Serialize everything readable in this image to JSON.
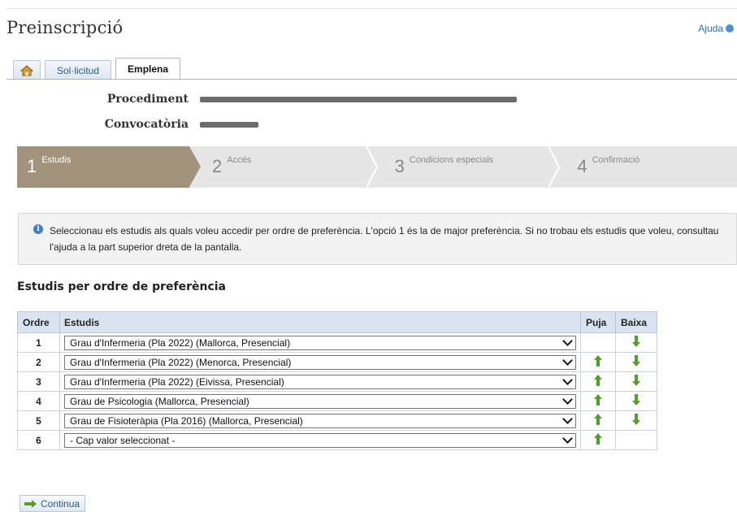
{
  "page": {
    "title": "Preinscripció",
    "help_label": "Ajuda"
  },
  "tabs": [
    {
      "name": "home",
      "label": ""
    },
    {
      "name": "solicitud",
      "label": "Sol·licitud"
    },
    {
      "name": "emplena",
      "label": "Emplena"
    }
  ],
  "info": {
    "procediment_label": "Procediment",
    "convocatoria_label": "Convocatòria"
  },
  "steps": [
    {
      "num": "1",
      "label": "Estudis",
      "active": true
    },
    {
      "num": "2",
      "label": "Accés"
    },
    {
      "num": "3",
      "label": "Condicions especials"
    },
    {
      "num": "4",
      "label": "Confirmació"
    }
  ],
  "notice": "Seleccionau els estudis als quals voleu accedir per ordre de preferència. L'opció 1 és la de major preferència. Si no trobau els estudis que voleu, consultau l'ajuda a la part superior dreta de la pantalla.",
  "section_title": "Estudis per ordre de preferència",
  "table": {
    "headers": {
      "ordre": "Ordre",
      "estudis": "Estudis",
      "puja": "Puja",
      "baixa": "Baixa"
    },
    "rows": [
      {
        "ordre": "1",
        "estudi": "Grau d'Infermeria (Pla 2022) (Mallorca, Presencial)",
        "puja": false,
        "baixa": true
      },
      {
        "ordre": "2",
        "estudi": "Grau d'Infermeria (Pla 2022) (Menorca, Presencial)",
        "puja": true,
        "baixa": true
      },
      {
        "ordre": "3",
        "estudi": "Grau d'Infermeria (Pla 2022) (Eivissa, Presencial)",
        "puja": true,
        "baixa": true
      },
      {
        "ordre": "4",
        "estudi": "Grau de Psicologia (Mallorca, Presencial)",
        "puja": true,
        "baixa": true
      },
      {
        "ordre": "5",
        "estudi": "Grau de Fisioteràpia (Pla 2016) (Mallorca, Presencial)",
        "puja": true,
        "baixa": true
      },
      {
        "ordre": "6",
        "estudi": "- Cap valor seleccionat -",
        "puja": true,
        "baixa": false
      }
    ]
  },
  "continue_label": "Continua",
  "colors": {
    "step_active": "#a2937d",
    "step_inactive": "#e6e6e6",
    "arrow_green": "#5a9c2c",
    "link_blue": "#2a6db8"
  },
  "icons": {
    "home": "home-icon",
    "help": "help-globe-icon",
    "info": "info-icon",
    "up": "arrow-up-icon",
    "down": "arrow-down-icon",
    "continue": "arrow-right-icon"
  }
}
